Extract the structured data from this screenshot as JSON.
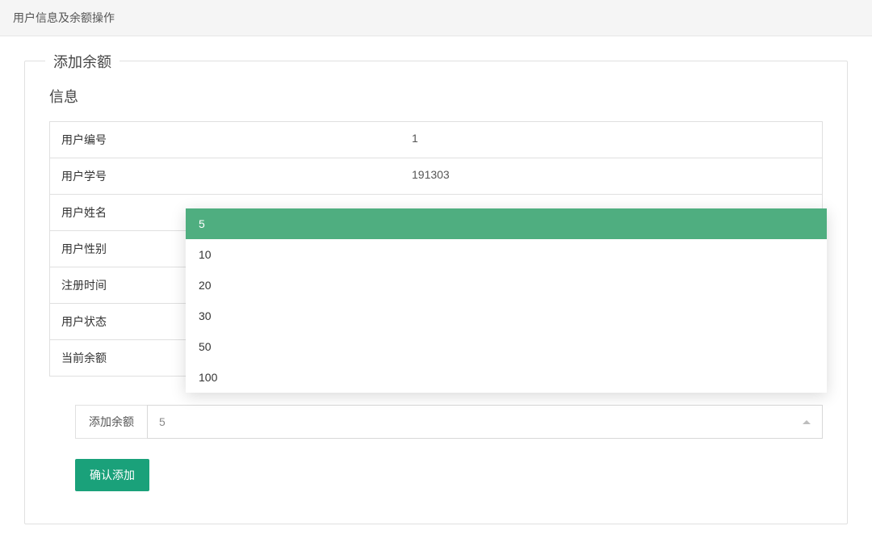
{
  "header": {
    "title": "用户信息及余额操作"
  },
  "panel": {
    "title": "添加余额",
    "subtitle": "信息"
  },
  "info": {
    "rows": [
      {
        "label": "用户编号",
        "value": "1"
      },
      {
        "label": "用户学号",
        "value": "191303"
      },
      {
        "label": "用户姓名",
        "value": ""
      },
      {
        "label": "用户性别",
        "value": ""
      },
      {
        "label": "注册时间",
        "value": ""
      },
      {
        "label": "用户状态",
        "value": ""
      },
      {
        "label": "当前余额",
        "value": ""
      }
    ]
  },
  "select": {
    "label": "添加余额",
    "value": "5",
    "options": [
      "5",
      "10",
      "20",
      "30",
      "50",
      "100"
    ],
    "selected_index": 0
  },
  "buttons": {
    "confirm": "确认添加"
  }
}
